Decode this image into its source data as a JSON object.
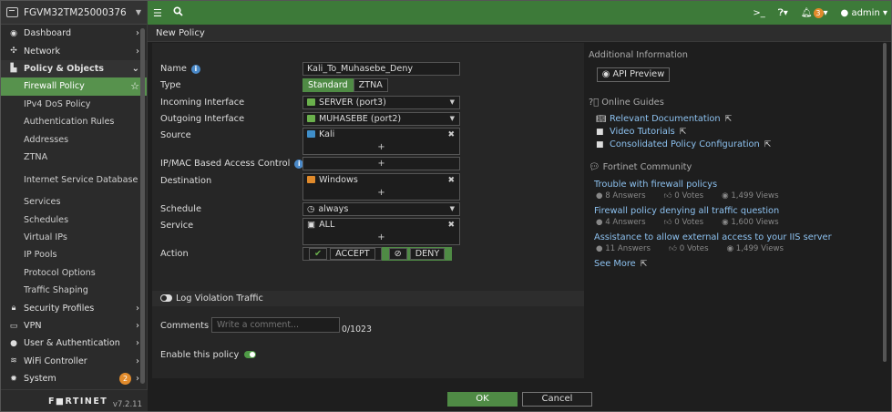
{
  "device": {
    "name": "FGVM32TM25000376"
  },
  "sidebar": {
    "items": [
      {
        "label": "Dashboard",
        "icon": "dashboard-icon"
      },
      {
        "label": "Network",
        "icon": "network-icon"
      },
      {
        "label": "Policy & Objects",
        "icon": "policy-icon"
      },
      {
        "label": "Firewall Policy"
      },
      {
        "label": "IPv4 DoS Policy"
      },
      {
        "label": "Authentication Rules"
      },
      {
        "label": "Addresses"
      },
      {
        "label": "ZTNA"
      },
      {
        "label": "Internet Service Database"
      },
      {
        "label": "Services"
      },
      {
        "label": "Schedules"
      },
      {
        "label": "Virtual IPs"
      },
      {
        "label": "IP Pools"
      },
      {
        "label": "Protocol Options"
      },
      {
        "label": "Traffic Shaping"
      },
      {
        "label": "Security Profiles",
        "icon": "lock-icon"
      },
      {
        "label": "VPN",
        "icon": "monitor-icon"
      },
      {
        "label": "User & Authentication",
        "icon": "user-icon"
      },
      {
        "label": "WiFi Controller",
        "icon": "wifi-icon"
      },
      {
        "label": "System",
        "icon": "gear-icon",
        "badge": "2"
      }
    ],
    "brand": "F■RTINET",
    "version": "v7.2.11"
  },
  "topbar": {
    "user": "admin",
    "notifications": "3"
  },
  "page": {
    "title": "New Policy"
  },
  "form": {
    "name_label": "Name",
    "name_value": "Kali_To_Muhasebe_Deny",
    "type_label": "Type",
    "type_options": [
      "Standard",
      "ZTNA"
    ],
    "incoming_label": "Incoming Interface",
    "incoming_value": "SERVER (port3)",
    "outgoing_label": "Outgoing Interface",
    "outgoing_value": "MUHASEBE (port2)",
    "source_label": "Source",
    "source_value": "Kali",
    "ipmac_label": "IP/MAC Based Access Control",
    "destination_label": "Destination",
    "destination_value": "Windows",
    "schedule_label": "Schedule",
    "schedule_value": "always",
    "service_label": "Service",
    "service_value": "ALL",
    "action_label": "Action",
    "action_options": [
      "ACCEPT",
      "DENY"
    ],
    "log_violation_label": "Log Violation Traffic",
    "comments_label": "Comments",
    "comments_placeholder": "Write a comment...",
    "comments_counter": "0/1023",
    "enable_label": "Enable this policy"
  },
  "right": {
    "additional_info": "Additional Information",
    "api_preview": "API Preview",
    "online_guides": "Online Guides",
    "guides": [
      "Relevant Documentation",
      "Video Tutorials",
      "Consolidated Policy Configuration"
    ],
    "community": "Fortinet Community",
    "posts": [
      {
        "title": "Trouble with firewall policys",
        "answers": "8 Answers",
        "votes": "0 Votes",
        "views": "1,499 Views"
      },
      {
        "title": "Firewall policy denying all traffic question",
        "answers": "4 Answers",
        "votes": "0 Votes",
        "views": "1,600 Views"
      },
      {
        "title": "Assistance to allow external access to your IIS server",
        "answers": "11 Answers",
        "votes": "0 Votes",
        "views": "1,499 Views"
      }
    ],
    "see_more": "See More"
  },
  "footer": {
    "ok": "OK",
    "cancel": "Cancel"
  },
  "colors": {
    "accent": "#3d7a39",
    "active": "#57924d",
    "link": "#8cc0ee",
    "badge": "#e18b2c"
  }
}
